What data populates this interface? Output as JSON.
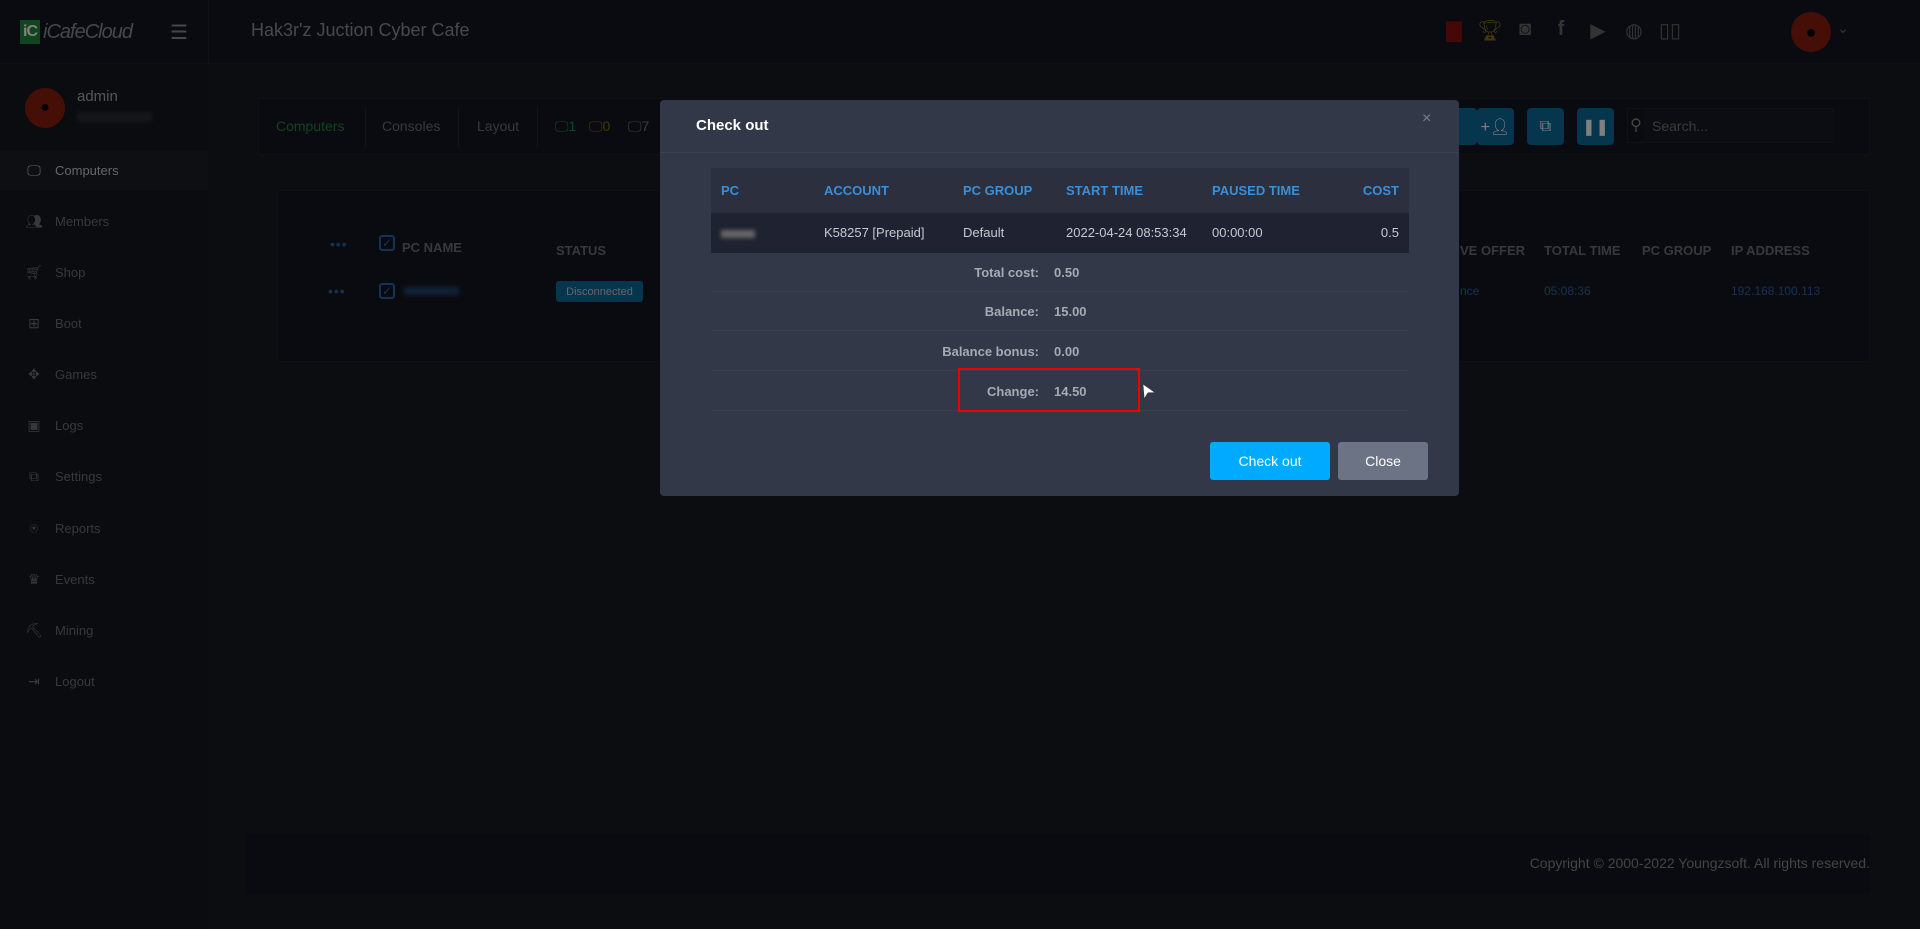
{
  "header": {
    "logo": "iCafeCloud",
    "logo_mark": "iC",
    "cafe_name": "Hak3r'z Juction Cyber Cafe",
    "icons": [
      "ranking-icon",
      "trophy-icon",
      "discord-icon",
      "facebook-icon",
      "youtube-icon",
      "globe-icon",
      "book-icon"
    ],
    "icon_colors": {
      "ranking": "#8b0f0f",
      "trophy": "#8a7410"
    }
  },
  "sidebar": {
    "username": "admin",
    "items": [
      {
        "label": "Computers",
        "icon": "monitor-icon"
      },
      {
        "label": "Members",
        "icon": "users-icon"
      },
      {
        "label": "Shop",
        "icon": "cart-icon"
      },
      {
        "label": "Boot",
        "icon": "windows-icon"
      },
      {
        "label": "Games",
        "icon": "gamepad-icon"
      },
      {
        "label": "Logs",
        "icon": "calendar-icon"
      },
      {
        "label": "Settings",
        "icon": "settings-icon"
      },
      {
        "label": "Reports",
        "icon": "award-icon"
      },
      {
        "label": "Events",
        "icon": "crown-icon"
      },
      {
        "label": "Mining",
        "icon": "pickaxe-icon"
      },
      {
        "label": "Logout",
        "icon": "logout-icon"
      }
    ]
  },
  "toolbar": {
    "tabs": [
      "Computers",
      "Consoles",
      "Layout"
    ],
    "counts": {
      "online": "1",
      "warning": "0",
      "offline": "7"
    },
    "search_placeholder": "Search..."
  },
  "table": {
    "headers": [
      "PC NAME",
      "STATUS",
      "VE OFFER",
      "TOTAL TIME",
      "PC GROUP",
      "IP ADDRESS"
    ],
    "row": {
      "status": "Disconnected",
      "offer": "nce",
      "total_time": "05:08:36",
      "pc_group": "",
      "ip": "192.168.100.113"
    }
  },
  "footer": {
    "copyright": "Copyright © 2000-2022 Youngzsoft. All rights reserved."
  },
  "modal": {
    "title": "Check out",
    "close_symbol": "×",
    "headers": [
      "PC",
      "ACCOUNT",
      "PC GROUP",
      "START TIME",
      "PAUSED TIME",
      "COST"
    ],
    "row": {
      "account": "K58257 [Prepaid]",
      "pc_group": "Default",
      "start_time": "2022-04-24 08:53:34",
      "paused_time": "00:00:00",
      "cost": "0.5"
    },
    "summary": [
      {
        "label": "Total cost:",
        "value": "0.50"
      },
      {
        "label": "Balance:",
        "value": "15.00"
      },
      {
        "label": "Balance bonus:",
        "value": "0.00"
      },
      {
        "label": "Change:",
        "value": "14.50"
      }
    ],
    "checkout_label": "Check out",
    "close_label": "Close"
  },
  "colors": {
    "accent": "#00aaff",
    "highlight": "#ee0000",
    "header_text": "#3a8fd9"
  }
}
